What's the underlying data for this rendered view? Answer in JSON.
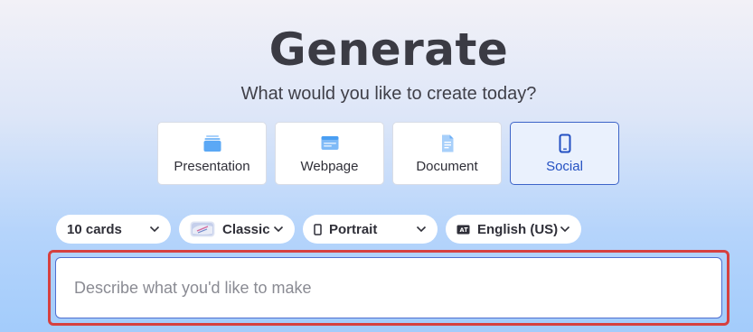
{
  "header": {
    "title": "Generate",
    "subtitle": "What would you like to create today?"
  },
  "content_types": [
    {
      "label": "Presentation",
      "icon": "presentation-icon",
      "selected": false
    },
    {
      "label": "Webpage",
      "icon": "webpage-icon",
      "selected": false
    },
    {
      "label": "Document",
      "icon": "document-icon",
      "selected": false
    },
    {
      "label": "Social",
      "icon": "phone-icon",
      "selected": true
    }
  ],
  "options": {
    "cards": "10 cards",
    "theme": "Classic",
    "orientation": "Portrait",
    "language": "English (US)"
  },
  "prompt": {
    "placeholder": "Describe what you'd like to make",
    "value": ""
  },
  "colors": {
    "accent": "#2350c2",
    "highlight_border": "#d6403f",
    "icon_blue": "#5ba8f5"
  }
}
